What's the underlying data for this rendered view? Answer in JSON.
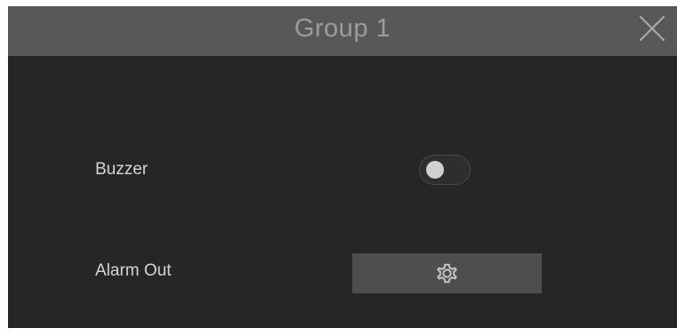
{
  "dialog": {
    "title": "Group 1",
    "close_icon": "close-icon"
  },
  "rows": {
    "buzzer": {
      "label": "Buzzer",
      "enabled": false
    },
    "alarm_out": {
      "label": "Alarm Out",
      "button_icon": "gear-icon"
    }
  },
  "colors": {
    "titlebar": "#585858",
    "background": "#262626",
    "button": "#4e4e4e",
    "text": "#d6d6d6"
  }
}
